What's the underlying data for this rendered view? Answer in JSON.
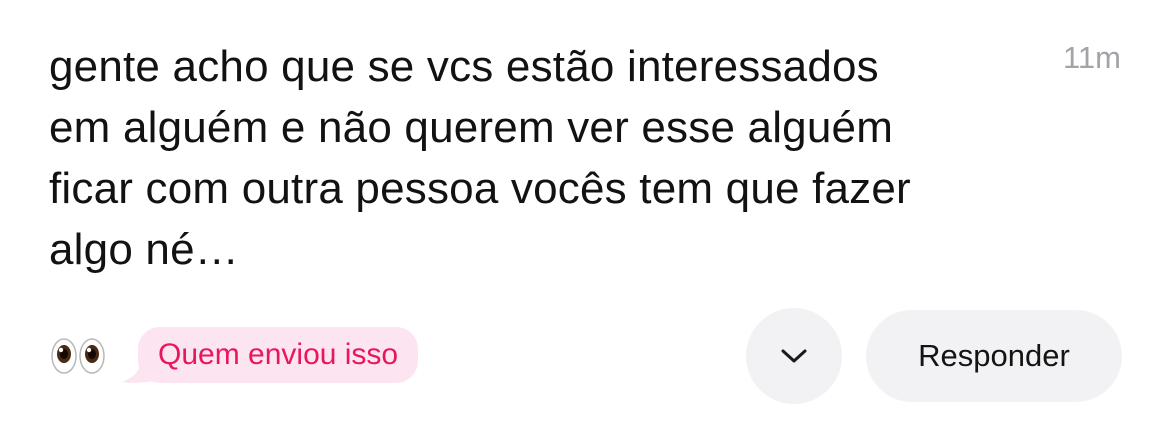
{
  "message": {
    "text": "gente acho que se vcs estão interessados em alguém e não querem ver esse alguém ficar com outra pessoa vocês tem que fazer algo né…",
    "lines": [
      "gente acho que se vcs estão interessados",
      "em alguém e não querem ver esse alguém",
      "ficar com outra pessoa vocês tem que fazer",
      "algo né…"
    ],
    "timestamp": "11m"
  },
  "actions": {
    "reaction_icon": "eyes-emoji",
    "who_sent_label": "Quem enviou isso",
    "more_icon": "chevron-down-icon",
    "reply_label": "Responder"
  },
  "colors": {
    "text": "#121212",
    "timestamp": "#a3a3a8",
    "pill_bg": "#fde4f1",
    "pill_text": "#e8175d",
    "button_bg": "#f2f2f4"
  }
}
